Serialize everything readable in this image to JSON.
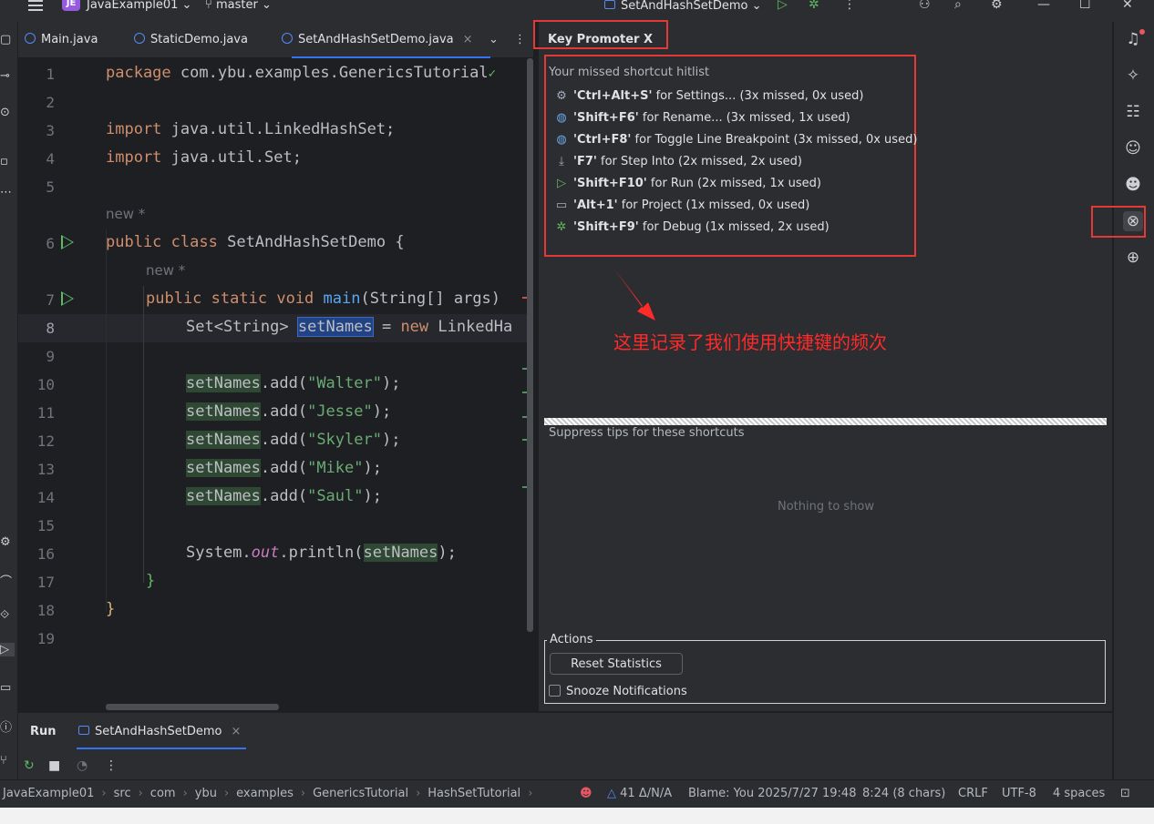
{
  "titlebar": {
    "project_badge": "JE",
    "project_name": "JavaExample01",
    "branch": "master",
    "run_config": "SetAndHashSetDemo"
  },
  "tabs": [
    {
      "label": "Main.java"
    },
    {
      "label": "StaticDemo.java"
    },
    {
      "label": "SetAndHashSetDemo.java",
      "close": "×"
    }
  ],
  "editor": {
    "line_numbers": [
      "1",
      "2",
      "3",
      "4",
      "5",
      "6",
      "7",
      "8",
      "9",
      "10",
      "11",
      "12",
      "13",
      "14",
      "15",
      "16",
      "17",
      "18",
      "19"
    ],
    "l1": {
      "kw": "package",
      "rest": " com.ybu.examples.GenericsTutorial"
    },
    "l3": {
      "kw": "import",
      "rest": " java.util.LinkedHashSet;"
    },
    "l4": {
      "kw": "import",
      "rest": " java.util.Set;"
    },
    "hint_new": "new *",
    "l6": {
      "kw1": "public",
      "kw2": "class",
      "name": " SetAndHashSetDemo {"
    },
    "l7": {
      "kw1": "public",
      "kw2": "static",
      "kw3": "void",
      "fn": "main",
      "rest": "(String[] args)"
    },
    "l8": {
      "type": "Set<String> ",
      "var": "setNames",
      "eq": " = ",
      "kw": "new",
      "rest": " LinkedHa"
    },
    "adds": [
      {
        "var": "setNames",
        "m": ".add(",
        "arg": "\"Walter\"",
        "end": ");"
      },
      {
        "var": "setNames",
        "m": ".add(",
        "arg": "\"Jesse\"",
        "end": ");"
      },
      {
        "var": "setNames",
        "m": ".add(",
        "arg": "\"Skyler\"",
        "end": ");"
      },
      {
        "var": "setNames",
        "m": ".add(",
        "arg": "\"Mike\"",
        "end": ");"
      },
      {
        "var": "setNames",
        "m": ".add(",
        "arg": "\"Saul\"",
        "end": ");"
      }
    ],
    "l16": {
      "pre": "System.",
      "st": "out",
      "mid": ".println(",
      "var": "setNames",
      "end": ");"
    },
    "l17": "}",
    "l18": "}"
  },
  "key_promoter": {
    "title": "Key Promoter X",
    "hitlist_title": "Your missed shortcut hitlist",
    "items": [
      {
        "icon": "gear-icon",
        "shortcut": "'Ctrl+Alt+S'",
        "text": " for Settings... (3x missed, 0x used)"
      },
      {
        "icon": "rename-icon",
        "shortcut": "'Shift+F6'",
        "text": " for Rename... (3x missed, 1x used)"
      },
      {
        "icon": "breakpoint-icon",
        "shortcut": "'Ctrl+F8'",
        "text": " for Toggle Line Breakpoint (3x missed, 0x used)"
      },
      {
        "icon": "step-into-icon",
        "shortcut": "'F7'",
        "text": " for Step Into (2x missed, 2x used)"
      },
      {
        "icon": "run-icon",
        "shortcut": "'Shift+F10'",
        "text": " for Run (2x missed, 1x used)"
      },
      {
        "icon": "folder-icon",
        "shortcut": "'Alt+1'",
        "text": " for Project (1x missed, 0x used)"
      },
      {
        "icon": "debug-icon",
        "shortcut": "'Shift+F9'",
        "text": " for Debug (1x missed, 2x used)"
      }
    ],
    "annotation": "这里记录了我们使用快捷键的频次",
    "suppress_title": "Suppress tips for these shortcuts",
    "empty_text": "Nothing to show",
    "actions_legend": "Actions",
    "reset_label": "Reset Statistics",
    "snooze_label": "Snooze Notifications"
  },
  "run_panel": {
    "label": "Run",
    "tab_label": "SetAndHashSetDemo",
    "close": "×"
  },
  "statusbar": {
    "breadcrumbs": [
      "JavaExample01",
      "src",
      "com",
      "ybu",
      "examples",
      "GenericsTutorial",
      "HashSetTutorial"
    ],
    "warnings": "41 Δ/N/A",
    "blame": "Blame: You 2025/7/27 19:48",
    "position": "8:24 (8 chars)",
    "line_sep": "CRLF",
    "encoding": "UTF-8",
    "indent": "4 spaces"
  },
  "colors": {
    "annotation_red": "#ff2a2a",
    "highlight_box": "#e53935",
    "accent": "#3574f0"
  }
}
